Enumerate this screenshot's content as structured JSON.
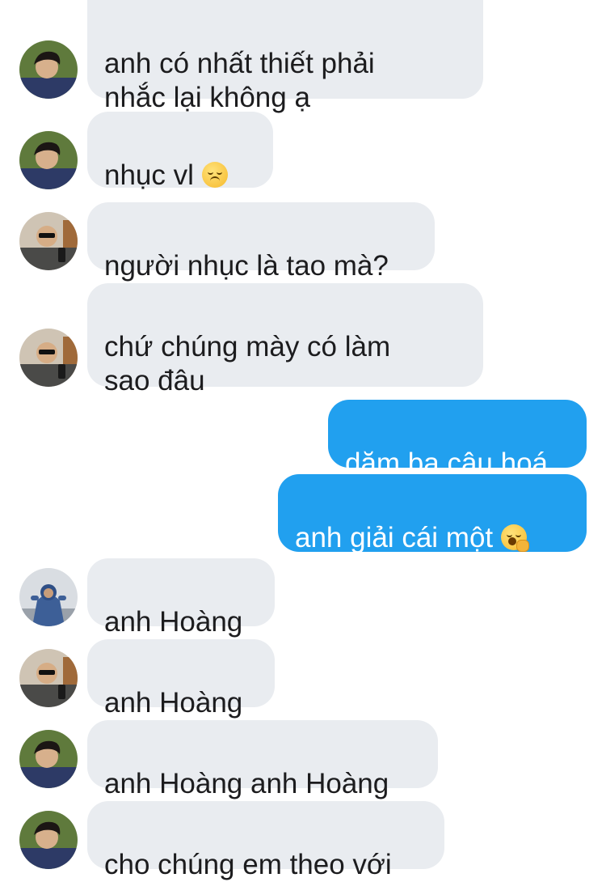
{
  "messages": [
    {
      "text": "anh có nhất thiết phải\nnhắc lại không ạ",
      "direction": "incoming",
      "avatar": "avatar-dark-hair-icon"
    },
    {
      "text": "nhục vl",
      "direction": "incoming",
      "avatar": "avatar-dark-hair-icon",
      "emoji": "disappointed-face-emoji"
    },
    {
      "text": "người nhục là tao mà?",
      "direction": "incoming",
      "avatar": "avatar-sunglasses-icon"
    },
    {
      "text": "chứ chúng mày có làm\nsao đâu",
      "direction": "incoming",
      "avatar": "avatar-sunglasses-icon"
    },
    {
      "text": "dăm ba câu hoá",
      "direction": "outgoing"
    },
    {
      "text": "anh giải cái một",
      "direction": "outgoing",
      "emoji": "yawning-face-emoji"
    },
    {
      "text": "anh Hoàng",
      "direction": "incoming",
      "avatar": "avatar-blue-jacket-icon"
    },
    {
      "text": "anh Hoàng",
      "direction": "incoming",
      "avatar": "avatar-sunglasses-icon"
    },
    {
      "text": "anh Hoàng anh Hoàng",
      "direction": "incoming",
      "avatar": "avatar-dark-hair-icon"
    },
    {
      "text": "cho chúng em theo với",
      "direction": "incoming",
      "avatar": "avatar-dark-hair-icon"
    }
  ],
  "colors": {
    "incoming_bubble": "#e9ecf0",
    "outgoing_bubble": "#21a0ef",
    "incoming_text": "#1c1c1e",
    "outgoing_text": "#ffffff"
  }
}
